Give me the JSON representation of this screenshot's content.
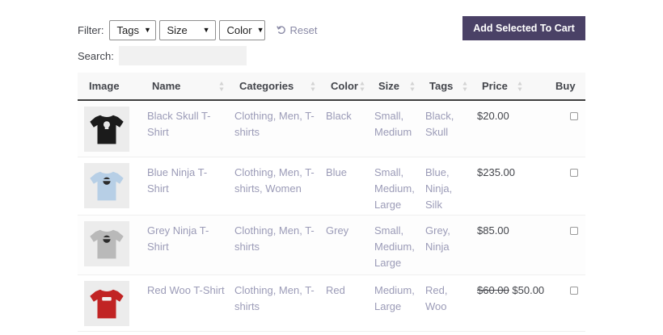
{
  "toolbar": {
    "filter_label": "Filter:",
    "filters": [
      {
        "label": "Tags"
      },
      {
        "label": "Size"
      },
      {
        "label": "Color"
      }
    ],
    "reset_label": "Reset",
    "add_to_cart_label": "Add Selected To Cart"
  },
  "search": {
    "label": "Search:",
    "value": ""
  },
  "table": {
    "headers": [
      "Image",
      "Name",
      "Categories",
      "Color",
      "Size",
      "Tags",
      "Price",
      "Buy"
    ],
    "rows": [
      {
        "shirt_color": "#1b1b1b",
        "logo": "skull",
        "name_lines": [
          "Black Skull T-",
          "Shirt"
        ],
        "cat_lines": [
          "Clothing, Men, T-",
          "shirts"
        ],
        "color": "Black",
        "size_lines": [
          "Small,",
          "Medium"
        ],
        "tag_lines": [
          "Black,",
          "Skull"
        ],
        "price": "$20.00",
        "old_price": ""
      },
      {
        "shirt_color": "#b7cfe6",
        "logo": "ninja",
        "name_lines": [
          "Blue Ninja T-",
          "Shirt"
        ],
        "cat_lines": [
          "Clothing, Men, T-",
          "shirts, Women"
        ],
        "color": "Blue",
        "size_lines": [
          "Small,",
          "Medium,",
          "Large"
        ],
        "tag_lines": [
          "Blue,",
          "Ninja,",
          "Silk"
        ],
        "price": "$235.00",
        "old_price": ""
      },
      {
        "shirt_color": "#b9b9b9",
        "logo": "ninja",
        "name_lines": [
          "Grey Ninja T-",
          "Shirt"
        ],
        "cat_lines": [
          "Clothing, Men, T-",
          "shirts"
        ],
        "color": "Grey",
        "size_lines": [
          "Small,",
          "Medium,",
          "Large"
        ],
        "tag_lines": [
          "Grey,",
          "Ninja"
        ],
        "price": "$85.00",
        "old_price": ""
      },
      {
        "shirt_color": "#c12424",
        "logo": "woo",
        "name_lines": [
          "Red Woo T-Shirt"
        ],
        "cat_lines": [
          "Clothing, Men, T-",
          "shirts"
        ],
        "color": "Red",
        "size_lines": [
          "Medium,",
          "Large"
        ],
        "tag_lines": [
          "Red,",
          "Woo"
        ],
        "price": "$50.00",
        "old_price": "$60.00"
      }
    ]
  },
  "colors": {
    "accent": "#4a4166",
    "link": "#9b9bb7",
    "text": "#43454b"
  }
}
